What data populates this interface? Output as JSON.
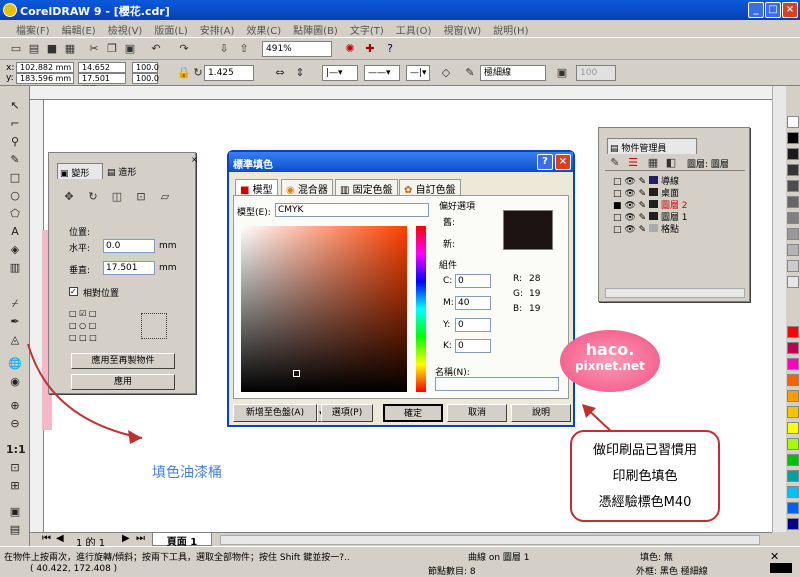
{
  "app": {
    "title": "CorelDRAW 9 - [櫻花.cdr]"
  },
  "menu": [
    "檔案(F)",
    "編輯(E)",
    "檢視(V)",
    "版面(L)",
    "安排(A)",
    "效果(C)",
    "點陣圖(B)",
    "文字(T)",
    "工具(O)",
    "視窗(W)",
    "說明(H)"
  ],
  "toolbar": {
    "zoom": "491%",
    "x": "102.882 mm",
    "y": "183.596 mm",
    "w": "14.652 mm",
    "h": "17.501 mm",
    "scale_x": "100.0",
    "scale_y": "100.0",
    "rotation": "1.425",
    "outline": "極細線"
  },
  "transform": {
    "tab1": "變形",
    "tab2": "造形",
    "section": "位置:",
    "h_label": "水平:",
    "h_value": "0.0",
    "v_label": "垂直:",
    "v_value": "17.501",
    "unit": "mm",
    "relative": "相對位置",
    "apply_dup": "應用至再製物件",
    "apply": "應用"
  },
  "dialog": {
    "title": "標準填色",
    "tabs": [
      "模型",
      "混合器",
      "固定色盤",
      "自訂色盤"
    ],
    "model_label": "模型(E):",
    "model_value": "CMYK",
    "ref_title": "偏好選項",
    "old_label": "舊:",
    "new_label": "新:",
    "group_title": "組件",
    "c_label": "C:",
    "c_value": "0",
    "m_label": "M:",
    "m_value": "40",
    "y_label": "Y:",
    "y_value": "0",
    "k_label": "K:",
    "k_value": "0",
    "r_label": "R:",
    "r_value": "28",
    "g_label": "G:",
    "g_value": "19",
    "b_label": "B:",
    "b_value": "19",
    "name_label": "名稱(N):",
    "add_palette": "新增至色盤(A)",
    "options": "選項(P)",
    "ok": "確定",
    "cancel": "取消",
    "help": "說明"
  },
  "obj_manager": {
    "title": "物件管理員",
    "layer": "圖層: 圖層",
    "items": [
      "導線",
      "桌面",
      "圖層 2",
      "圖層 1",
      "格點"
    ]
  },
  "annotations": {
    "bucket": "填色油漆桶",
    "logo1": "haco.",
    "logo2": "pixnet.net",
    "callout": [
      "做印刷品已習慣用",
      "印刷色填色",
      "憑經驗標色M40"
    ]
  },
  "pagebar": {
    "pages": "1 的 1",
    "page": "頁面 1"
  },
  "status": {
    "hint": "在物件上按兩次，進行旋轉/傾斜；按兩下工具，選取全部物件；按住 Shift 鍵並按一?..",
    "coords": "( 40.422, 172.408 )",
    "selection": "曲線 on 圖層 1",
    "nodes": "節點數目: 8",
    "fill": "填色: 無",
    "outline": "外框: 黑色  極細線"
  },
  "colors": {
    "accent": "#0a4ed0",
    "red": "#c03030"
  }
}
